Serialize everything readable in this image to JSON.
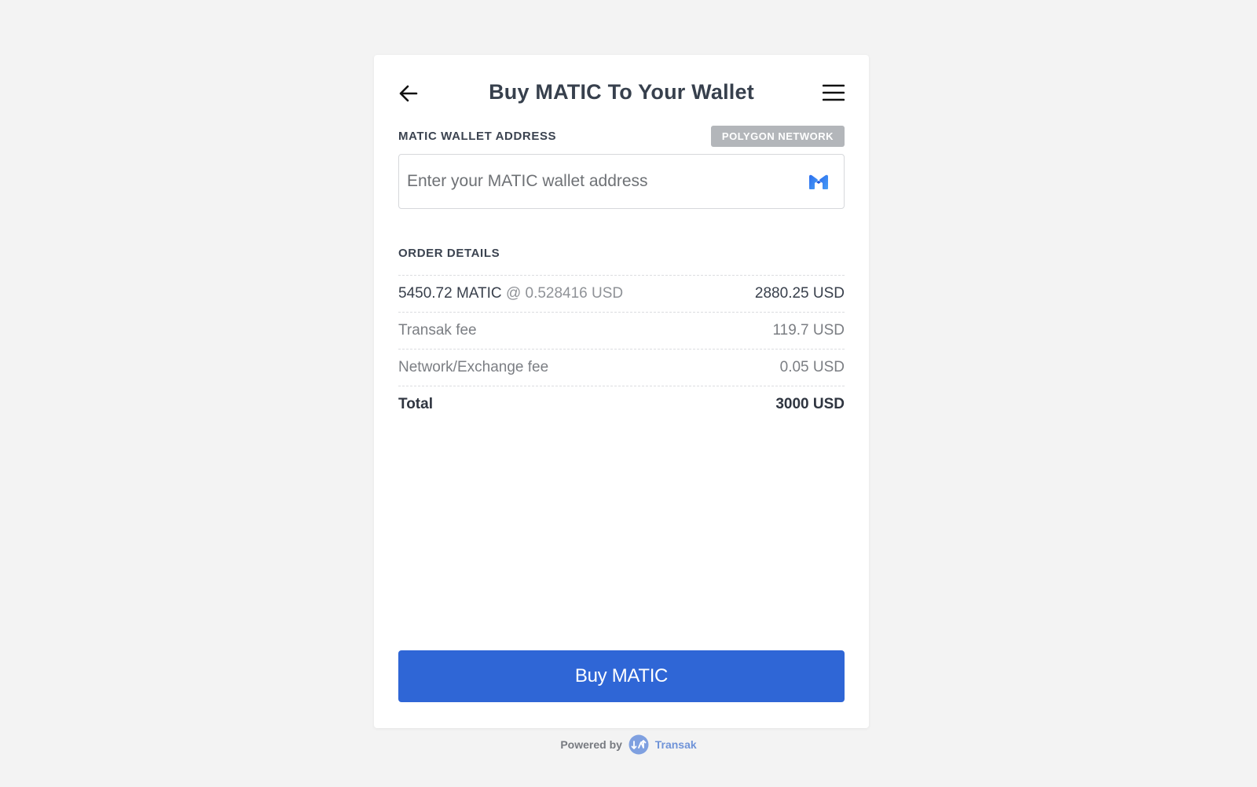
{
  "header": {
    "title": "Buy MATIC To Your Wallet"
  },
  "wallet": {
    "label": "MATIC WALLET ADDRESS",
    "network_badge": "POLYGON NETWORK",
    "placeholder": "Enter your MATIC wallet address",
    "value": ""
  },
  "order": {
    "label": "ORDER DETAILS",
    "main_row": {
      "amount": "5450.72 MATIC",
      "rate": "@ 0.528416 USD",
      "value": "2880.25 USD"
    },
    "fee_rows": [
      {
        "label": "Transak fee",
        "value": "119.7 USD"
      },
      {
        "label": "Network/Exchange fee",
        "value": "0.05 USD"
      }
    ],
    "total": {
      "label": "Total",
      "value": "3000 USD"
    }
  },
  "buy_button": {
    "label": "Buy MATIC"
  },
  "footer": {
    "powered_by": "Powered by",
    "brand": "Transak"
  },
  "colors": {
    "accent": "#2f66d6",
    "badge": "#b3b6ba",
    "background": "#f3f3f3"
  },
  "icons": {
    "back": "arrow-left-icon",
    "menu": "hamburger-menu-icon",
    "token": "matic-logo-icon",
    "brand": "transak-logo-icon"
  }
}
